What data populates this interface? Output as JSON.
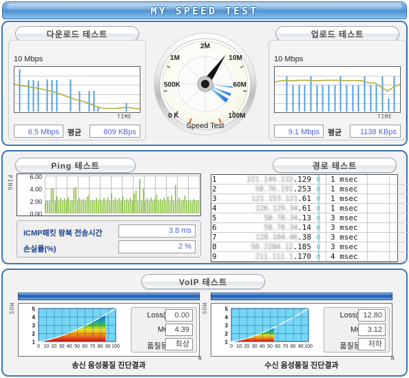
{
  "window": {
    "title": "MY SPEED TEST"
  },
  "download": {
    "header": "다운로드 테스트",
    "unit": "10 Mbps",
    "time_axis": "TIME",
    "speed": "6.5 Mbps",
    "avg_label": "평균",
    "avg_value": "809 KBps",
    "bar_color": "#4d9fe0",
    "line_color": "#b5ae3a"
  },
  "upload": {
    "header": "업로드 테스트",
    "unit": "10 Mbps",
    "time_axis": "TIME",
    "speed": "9.1 Mbps",
    "avg_label": "평균",
    "avg_value": "1138 KBps",
    "bar_color": "#4d9fe0",
    "line_color": "#b5ae3a"
  },
  "gauge": {
    "caption": "Speed Test",
    "ticks": [
      "0 K",
      "500K",
      "1M",
      "2M",
      "10M",
      "60M",
      "100M"
    ],
    "needle_label": "10M"
  },
  "ping": {
    "header": "Ping 테스트",
    "axis_vertical": "PING",
    "y_ticks": [
      "6.00",
      "4.00",
      "2.00",
      "0.00"
    ],
    "rtt_label": "ICMP패킷 왕복 전송시간",
    "rtt_value": "3.8 ms",
    "loss_label": "손실률(%)",
    "loss_value": "2 %",
    "bar_color": "#8ac43c"
  },
  "route": {
    "header": "경로 테스트",
    "rows": [
      {
        "hop": "1",
        "ip_masked": "221.149.132",
        "ip_last": ".129",
        "latency": "1  msec"
      },
      {
        "hop": "2",
        "ip_masked": "58.76.191",
        "ip_last": ".253",
        "latency": "1  msec"
      },
      {
        "hop": "3",
        "ip_masked": "121.153.121",
        "ip_last": ".61",
        "latency": "1  msec"
      },
      {
        "hop": "4",
        "ip_masked": "226.129.34",
        "ip_last": ".61",
        "latency": "1  msec"
      },
      {
        "hop": "5",
        "ip_masked": "58.78.34",
        "ip_last": ".13",
        "latency": "3  msec"
      },
      {
        "hop": "6",
        "ip_masked": "58.78.34",
        "ip_last": ".14",
        "latency": "3  msec"
      },
      {
        "hop": "7",
        "ip_masked": "128.104.46",
        "ip_last": ".38",
        "latency": "3  msec"
      },
      {
        "hop": "8",
        "ip_masked": "58.2284.12",
        "ip_last": ".185",
        "latency": "3  msec"
      },
      {
        "hop": "9",
        "ip_masked": "211.111.1",
        "ip_last": ".170",
        "latency": "4  msec"
      }
    ]
  },
  "voip": {
    "header": "VoIP 테스트",
    "axis_vertical": "MOS",
    "y_ticks": [
      "5",
      "4",
      "3",
      "2",
      "1"
    ],
    "x_ticks": [
      "0",
      "10",
      "20",
      "30",
      "40",
      "50",
      "60",
      "70",
      "80",
      "90",
      "100"
    ],
    "corner_mark": "R",
    "send": {
      "caption": "송신 음성품질 진단결과",
      "loss_label": "Loss(%)",
      "loss_value": "0.00",
      "mos_label": "MOS",
      "mos_value": "4.39",
      "grade_label": "품질등급",
      "grade_value": "최상",
      "fill_ratio": 0.87
    },
    "recv": {
      "caption": "수신 음성품질 진단결과",
      "loss_label": "Loss(%)",
      "loss_value": "12.80",
      "mos_label": "MOS",
      "mos_value": "3.12",
      "grade_label": "품질등급",
      "grade_value": "저하",
      "fill_ratio": 0.55
    }
  },
  "chart_data": {
    "type": "line",
    "title": "MY SPEED TEST",
    "charts": [
      {
        "type": "bar",
        "name": "download",
        "ylabel": "10 Mbps",
        "xlabel": "TIME",
        "ylim": [
          0,
          10
        ],
        "bars": [
          9.6,
          0,
          7.2,
          7.2,
          6.9,
          0,
          7.3,
          7.2,
          7.2,
          0,
          0,
          7.3,
          0,
          4.6,
          0,
          4.7,
          4.7,
          1.0,
          0,
          0,
          0,
          0,
          0,
          2.0,
          0,
          0
        ],
        "line": [
          6.2,
          5.9,
          5.8,
          5.6,
          5.4,
          5.2,
          5.0,
          4.7,
          4.4,
          4.0,
          3.6,
          3.2,
          2.8,
          2.5,
          2.2,
          1.8,
          1.3,
          0.9,
          0.7,
          0.7,
          0.7,
          0.8,
          0.9,
          0.9,
          0.7,
          0.6
        ]
      },
      {
        "type": "bar",
        "name": "upload",
        "ylabel": "10 Mbps",
        "xlabel": "TIME",
        "ylim": [
          0,
          10
        ],
        "bars": [
          0,
          8.0,
          6.0,
          6.0,
          6.0,
          8.0,
          6.0,
          6.0,
          6.0,
          6.0,
          8.0,
          6.0,
          6.0,
          6.0,
          8.0,
          6.0,
          6.0,
          8.0,
          3.0,
          8.0
        ],
        "line": [
          6.7,
          7.0,
          7.0,
          7.0,
          7.1,
          7.1,
          7.0,
          7.0,
          7.1,
          7.1,
          7.1,
          7.0,
          7.0,
          7.0,
          7.0,
          6.5,
          6.5,
          5.6,
          4.6,
          5.6,
          6.2
        ]
      },
      {
        "type": "bar",
        "name": "ping",
        "ylabel": "PING",
        "ylim": [
          0,
          6
        ],
        "y_ticks": [
          0.0,
          2.0,
          4.0,
          6.0
        ],
        "values": [
          2.0,
          2.1,
          2.0,
          4.2,
          4.3,
          2.0,
          2.9,
          2.0,
          2.6,
          2.0,
          2.5,
          2.0,
          2.7,
          2.0,
          2.2,
          4.3,
          4.5,
          2.0,
          2.6,
          2.0,
          2.4,
          2.0,
          2.8,
          3.1,
          2.0,
          2.2,
          2.0,
          2.6,
          2.0,
          2.3,
          2.0,
          2.6,
          2.0,
          2.7,
          2.0,
          3.4,
          2.0,
          2.6,
          2.0,
          2.5,
          2.0,
          2.9,
          2.0,
          2.4,
          2.0,
          2.6,
          2.0,
          3.3,
          3.9,
          2.0,
          5.9,
          2.0,
          4.2,
          2.0,
          2.5,
          2.0,
          2.7,
          2.0,
          2.4,
          3.2,
          2.0,
          2.4,
          2.0,
          2.7,
          2.0,
          2.9,
          2.0,
          3.0,
          2.0,
          4.8,
          2.0,
          2.6,
          2.0,
          2.3,
          3.0,
          2.0,
          2.2,
          2.0,
          2.0,
          2.4,
          2.0,
          2.2
        ]
      },
      {
        "type": "area",
        "name": "voip-send",
        "ylabel": "MOS",
        "ylim": [
          1,
          5
        ],
        "xlim": [
          0,
          100
        ],
        "fill_to_x": 87,
        "curve_end_mos": 4.6
      },
      {
        "type": "area",
        "name": "voip-recv",
        "ylabel": "MOS",
        "ylim": [
          1,
          5
        ],
        "xlim": [
          0,
          100
        ],
        "fill_to_x": 55,
        "curve_end_mos": 4.8
      }
    ]
  }
}
